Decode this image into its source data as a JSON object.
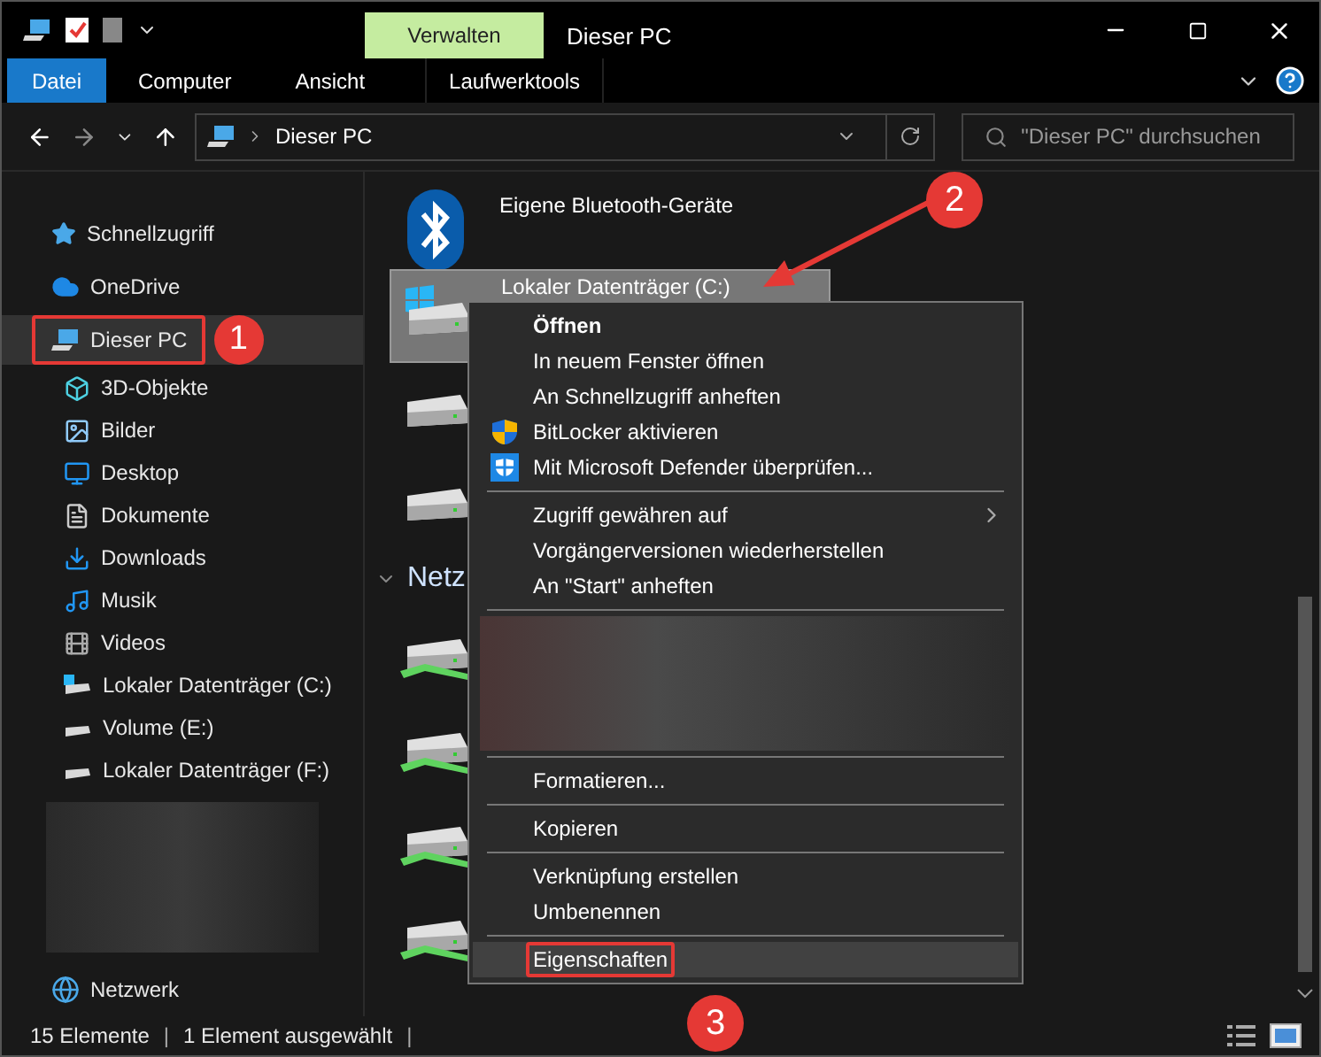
{
  "title_bar": {
    "context_tab": "Verwalten",
    "title": "Dieser PC"
  },
  "ribbon_tabs": [
    {
      "label": "Datei",
      "kind": "file"
    },
    {
      "label": "Computer",
      "kind": "tab"
    },
    {
      "label": "Ansicht",
      "kind": "tab"
    },
    {
      "label": "Laufwerktools",
      "kind": "context"
    }
  ],
  "address_bar": {
    "path": "Dieser PC"
  },
  "search": {
    "placeholder": "\"Dieser PC\" durchsuchen"
  },
  "sidebar": {
    "items": [
      {
        "kind": "item",
        "label": "Schnellzugriff",
        "selected": false
      },
      {
        "kind": "item",
        "label": "OneDrive",
        "selected": false
      },
      {
        "kind": "item",
        "label": "Dieser PC",
        "selected": true,
        "children": [
          {
            "label": "3D-Objekte",
            "selected": false
          },
          {
            "label": "Bilder",
            "selected": false
          },
          {
            "label": "Desktop",
            "selected": false
          },
          {
            "label": "Dokumente",
            "selected": false
          },
          {
            "label": "Downloads",
            "selected": false
          },
          {
            "label": "Musik",
            "selected": false
          },
          {
            "label": "Videos",
            "selected": false
          },
          {
            "label": "Lokaler Datenträger (C:)",
            "selected": false
          },
          {
            "label": "Volume (E:)",
            "selected": false
          },
          {
            "label": "Lokaler Datenträger (F:)",
            "selected": false
          }
        ]
      },
      {
        "kind": "redacted"
      },
      {
        "kind": "item",
        "label": "Netzwerk",
        "selected": false
      }
    ]
  },
  "content": {
    "sections": [
      {
        "items": [
          {
            "kind": "bluetooth",
            "label": "Eigene Bluetooth-Geräte",
            "selected": false
          },
          {
            "kind": "system-drive",
            "label": "Lokaler Datenträger (C:)",
            "selected": true
          },
          {
            "kind": "drive",
            "selected": false
          },
          {
            "kind": "drive",
            "selected": false
          }
        ]
      },
      {
        "header": "Netz",
        "items": [
          {
            "kind": "network-drive",
            "selected": false
          },
          {
            "kind": "network-drive",
            "selected": false
          },
          {
            "kind": "network-drive",
            "selected": false
          },
          {
            "kind": "network-drive",
            "selected": false
          }
        ]
      }
    ]
  },
  "context_menu": {
    "entries": [
      {
        "kind": "item",
        "label": "Öffnen",
        "bold": true,
        "highlighted": false
      },
      {
        "kind": "item",
        "label": "In neuem Fenster öffnen",
        "highlighted": false
      },
      {
        "kind": "item",
        "label": "An Schnellzugriff anheften",
        "highlighted": false
      },
      {
        "kind": "item",
        "label": "BitLocker aktivieren",
        "highlighted": false
      },
      {
        "kind": "item",
        "label": "Mit Microsoft Defender überprüfen...",
        "highlighted": false
      },
      {
        "kind": "separator"
      },
      {
        "kind": "item",
        "label": "Zugriff gewähren auf",
        "submenu": true,
        "highlighted": false
      },
      {
        "kind": "item",
        "label": "Vorgängerversionen wiederherstellen",
        "highlighted": false
      },
      {
        "kind": "item",
        "label": "An \"Start\" anheften",
        "highlighted": false
      },
      {
        "kind": "separator"
      },
      {
        "kind": "redacted"
      },
      {
        "kind": "separator"
      },
      {
        "kind": "item",
        "label": "Formatieren...",
        "highlighted": false
      },
      {
        "kind": "separator"
      },
      {
        "kind": "item",
        "label": "Kopieren",
        "highlighted": false
      },
      {
        "kind": "separator"
      },
      {
        "kind": "item",
        "label": "Verknüpfung erstellen",
        "highlighted": false
      },
      {
        "kind": "item",
        "label": "Umbenennen",
        "highlighted": false
      },
      {
        "kind": "separator"
      },
      {
        "kind": "item",
        "label": "Eigenschaften",
        "highlighted": true
      }
    ]
  },
  "status_bar": {
    "texts": [
      "15 Elemente",
      "|",
      "1 Element ausgewählt",
      "|"
    ]
  },
  "annotations": [
    {
      "label": "1"
    },
    {
      "label": "2"
    },
    {
      "label": "3"
    }
  ]
}
